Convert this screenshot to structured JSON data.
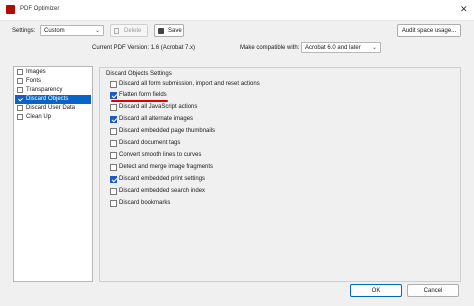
{
  "window": {
    "title": "PDF Optimizer",
    "close_glyph": "✕"
  },
  "toolbar": {
    "settings_label": "Settings:",
    "settings_value": "Custom",
    "delete_label": "Delete",
    "save_label": "Save",
    "audit_label": "Audit space usage..."
  },
  "version": {
    "current_label": "Current PDF Version: 1.6 (Acrobat 7.x)",
    "compat_label": "Make compatible with:",
    "compat_value": "Acrobat 6.0 and later"
  },
  "sidebar": {
    "items": [
      {
        "label": "Images",
        "checked": false,
        "selected": false
      },
      {
        "label": "Fonts",
        "checked": false,
        "selected": false
      },
      {
        "label": "Transparency",
        "checked": false,
        "selected": false
      },
      {
        "label": "Discard Objects",
        "checked": true,
        "selected": true
      },
      {
        "label": "Discard User Data",
        "checked": false,
        "selected": false
      },
      {
        "label": "Clean Up",
        "checked": false,
        "selected": false
      }
    ]
  },
  "group": {
    "title": "Discard Objects Settings",
    "options": [
      {
        "label": "Discard all form submission, import and reset actions",
        "checked": false
      },
      {
        "label": "Flatten form fields",
        "checked": true
      },
      {
        "label": "Discard all JavaScript actions",
        "checked": false
      },
      {
        "label": "Discard all alternate images",
        "checked": true
      },
      {
        "label": "Discard embedded page thumbnails",
        "checked": false
      },
      {
        "label": "Discard document tags",
        "checked": false
      },
      {
        "label": "Convert smooth lines to curves",
        "checked": false
      },
      {
        "label": "Detect and merge image fragments",
        "checked": false
      },
      {
        "label": "Discard embedded print settings",
        "checked": true
      },
      {
        "label": "Discard embedded search index",
        "checked": false
      },
      {
        "label": "Discard bookmarks",
        "checked": false
      }
    ]
  },
  "footer": {
    "ok_label": "OK",
    "cancel_label": "Cancel"
  },
  "colors": {
    "accent": "#0a64c8",
    "annotation": "#e00000"
  }
}
